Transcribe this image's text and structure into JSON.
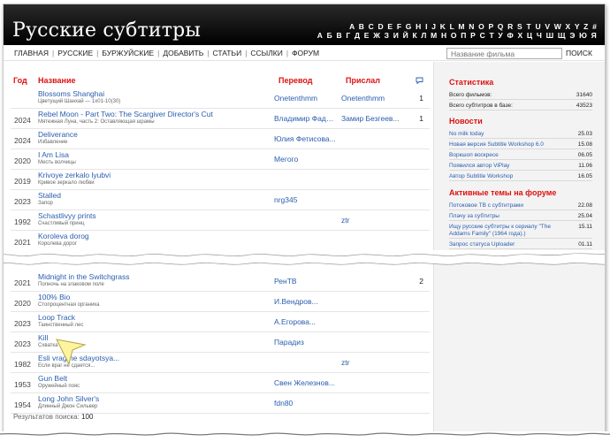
{
  "site": {
    "logo": "Русские субтитры",
    "alphabet_latin": "A B C D E F G H I J K L M N O P Q R S T U V W X Y Z #",
    "alphabet_cyrillic": "А Б В Г Д Е Ж З И Й К Л М Н О П Р С Т У Ф Х Ц Ч Ш Щ Э Ю Я"
  },
  "nav": {
    "items": [
      "ГЛАВНАЯ",
      "РУССКИЕ",
      "БУРЖУЙСКИЕ",
      "ДОБАВИТЬ",
      "СТАТЬИ",
      "ССЫЛКИ",
      "ФОРУМ"
    ],
    "search_placeholder": "Название фильма",
    "search_button": "ПОИСК"
  },
  "table": {
    "headers": {
      "year": "Год",
      "title": "Название",
      "translation": "Перевод",
      "sender": "Прислал"
    },
    "rows_top": [
      {
        "year": "",
        "title": "Blossoms Shanghai",
        "subtitle": "Цветущий Шанхай — 1x01-10(30)",
        "translation": "Onetenthmm",
        "sender": "Onetenthmm",
        "count": "1"
      },
      {
        "year": "2024",
        "title": "Rebel Moon - Part Two: The Scargiver Director's Cut",
        "subtitle": "Мятежная Луна, часть 2: Оставляющая шрамы",
        "translation": "Владимир Фадее...",
        "sender": "Замир Безгеев...",
        "count": "1"
      },
      {
        "year": "2024",
        "title": "Deliverance",
        "subtitle": "Избавление",
        "translation": "Юлия Фетисова...",
        "sender": "",
        "count": ""
      },
      {
        "year": "2020",
        "title": "I Am Lisa",
        "subtitle": "Месть волчицы",
        "translation": "Мегого",
        "sender": "",
        "count": ""
      },
      {
        "year": "2019",
        "title": "Krivoye zerkalo lyubvi",
        "subtitle": "Кривое зеркало любви",
        "translation": "",
        "sender": "",
        "count": ""
      },
      {
        "year": "2023",
        "title": "Stalled",
        "subtitle": "Запор",
        "translation": "nrg345",
        "sender": "",
        "count": ""
      },
      {
        "year": "1992",
        "title": "Schastlivyy prints",
        "subtitle": "Счастливый принц",
        "translation": "",
        "sender": "ztr",
        "count": ""
      },
      {
        "year": "2021",
        "title": "Koroleva dorog",
        "subtitle": "Королева дорог",
        "translation": "",
        "sender": "",
        "count": ""
      }
    ],
    "rows_bottom": [
      {
        "year": "2021",
        "title": "Midnight in the Switchgrass",
        "subtitle": "Полночь на злаковом поле",
        "translation": "РенТВ",
        "sender": "",
        "count": "2"
      },
      {
        "year": "2020",
        "title": "100% Bio",
        "subtitle": "Стопроцентная органика",
        "translation": "И.Вендров...",
        "sender": "",
        "count": ""
      },
      {
        "year": "2023",
        "title": "Loop Track",
        "subtitle": "Таинственный лес",
        "translation": "А.Егорова...",
        "sender": "",
        "count": ""
      },
      {
        "year": "2023",
        "title": "Kill",
        "subtitle": "Схватка",
        "translation": "Парадиз",
        "sender": "",
        "count": ""
      },
      {
        "year": "1982",
        "title": "Esli vrag ne sdayotsya...",
        "subtitle": "Если враг не сдается...",
        "translation": "",
        "sender": "ztr",
        "count": ""
      },
      {
        "year": "1953",
        "title": "Gun Belt",
        "subtitle": "Оружейный пояс",
        "translation": "Свен Железнов...",
        "sender": "",
        "count": ""
      },
      {
        "year": "1954",
        "title": "Long John Silver's",
        "subtitle": "Длинный Джон Сильвер",
        "translation": "fdn80",
        "sender": "",
        "count": ""
      }
    ],
    "results_label": "Результатов поиска:",
    "results_count": "100"
  },
  "sidebar": {
    "stats_title": "Статистика",
    "stats": [
      {
        "label": "Всего фильмов:",
        "value": "31640"
      },
      {
        "label": "Всего субтитров в базе:",
        "value": "43523"
      }
    ],
    "news_title": "Новости",
    "news": [
      {
        "label": "No milk today",
        "date": "25.03"
      },
      {
        "label": "Новая версия Subtitle Workshop 6.0",
        "date": "15.08"
      },
      {
        "label": "Воркшоп воскресе",
        "date": "06.05"
      },
      {
        "label": "Появился автор ViPlay",
        "date": "11.06"
      },
      {
        "label": "Автор Subtitle Workshop",
        "date": "16.05"
      }
    ],
    "forum_title": "Активные темы на форуме",
    "forum": [
      {
        "label": "Потоковое ТВ с субтитрами",
        "date": "22.08"
      },
      {
        "label": "Плачу за субтитры",
        "date": "25.04"
      },
      {
        "label": "Ищу русские субтитры к сериалу \"The",
        "label2": "Addams Family\" (1964 года).)",
        "date": "15.11"
      },
      {
        "label": "Запрос статуса Uploader",
        "date": "01.11"
      }
    ]
  },
  "colors": {
    "header_bg": "#000000",
    "accent_red": "#dd1111",
    "link_blue": "#2a5db0",
    "sidebar_bg": "#f3f3f3"
  }
}
